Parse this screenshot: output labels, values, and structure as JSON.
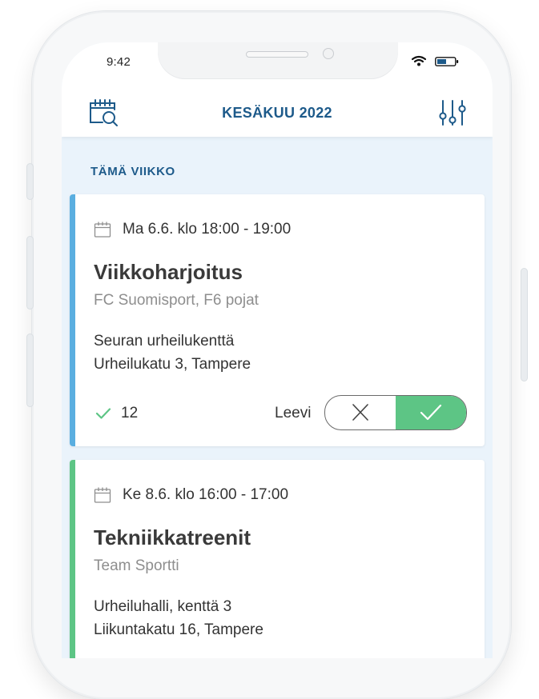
{
  "status_bar": {
    "time": "9:42"
  },
  "header": {
    "title": "KESÄKUU 2022",
    "left_icon": "calendar-search-icon",
    "right_icon": "filter-sliders-icon"
  },
  "section": {
    "title": "TÄMÄ VIIKKO"
  },
  "events": [
    {
      "date": "Ma 6.6. klo 18:00 - 19:00",
      "title": "Viikkoharjoitus",
      "team": "FC Suomisport, F6 pojat",
      "place": "Seuran urheilukenttä",
      "address": "Urheilukatu 3, Tampere",
      "attending_count": "12",
      "participant": "Leevi",
      "response": "accepted",
      "accent_color": "#5aaee0"
    },
    {
      "date": "Ke 8.6. klo 16:00 - 17:00",
      "title": "Tekniikkatreenit",
      "team": "Team Sportti",
      "place": "Urheiluhalli, kenttä 3",
      "address": "Liikuntakatu 16, Tampere",
      "accent_color": "#5dc585"
    }
  ],
  "colors": {
    "brand": "#1d5a8a",
    "accept": "#5dc585",
    "background": "#eaf3fb"
  }
}
